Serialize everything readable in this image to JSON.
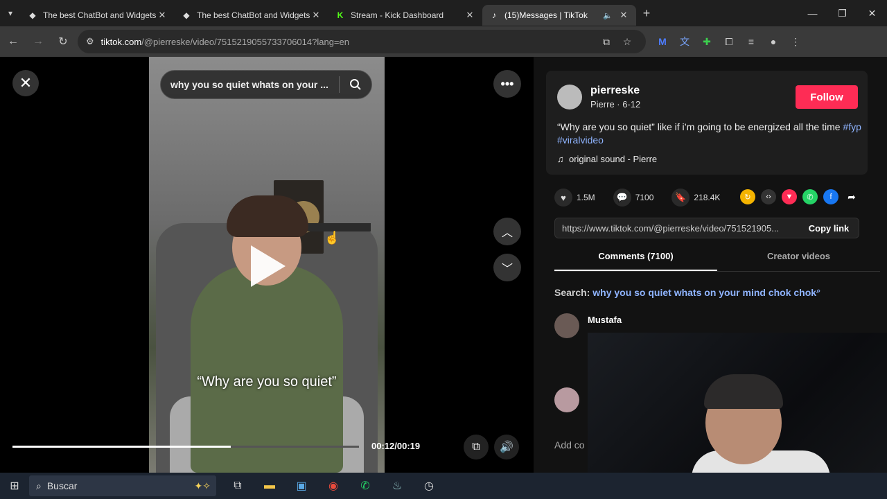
{
  "browser": {
    "tabs": [
      {
        "title": "The best ChatBot and Widgets",
        "icon": "botrix-icon",
        "active": false
      },
      {
        "title": "The best ChatBot and Widgets",
        "icon": "botrix-icon",
        "active": false
      },
      {
        "title": "Stream - Kick Dashboard",
        "icon": "kick-icon",
        "active": false
      },
      {
        "title": "(15)Messages | TikTok",
        "icon": "tiktok-icon",
        "active": true
      }
    ],
    "url_host": "tiktok.com",
    "url_path": "/@pierreske/video/7515219055733706014?lang=en"
  },
  "video": {
    "search_query": "why you so quiet whats on your ...",
    "caption": "“Why are you so quiet”",
    "time": "00:12/00:19",
    "progress": 0.63
  },
  "post": {
    "username": "pierreske",
    "nickname": "Pierre · 6-12",
    "follow_label": "Follow",
    "description": "“Why are you so quiet” like if i’m going to be energized all the time",
    "hashtags": [
      "#fyp",
      "#viralvideo"
    ],
    "sound": "original sound - Pierre",
    "likes": "1.5M",
    "comments": "7100",
    "saves": "218.4K",
    "link": "https://www.tiktok.com/@pierreske/video/751521905...",
    "copy_label": "Copy link"
  },
  "comments_panel": {
    "tab_comments": "Comments (7100)",
    "tab_creator": "Creator videos",
    "search_label": "Search:",
    "search_query": "why you so quiet whats on your mind chok chok",
    "first_comment_author": "Mustafa",
    "add_comment": "Add co"
  },
  "taskbar": {
    "search_placeholder": "Buscar"
  },
  "colors": {
    "follow": "#fe2c55",
    "hashtag": "#8fb4ff"
  }
}
